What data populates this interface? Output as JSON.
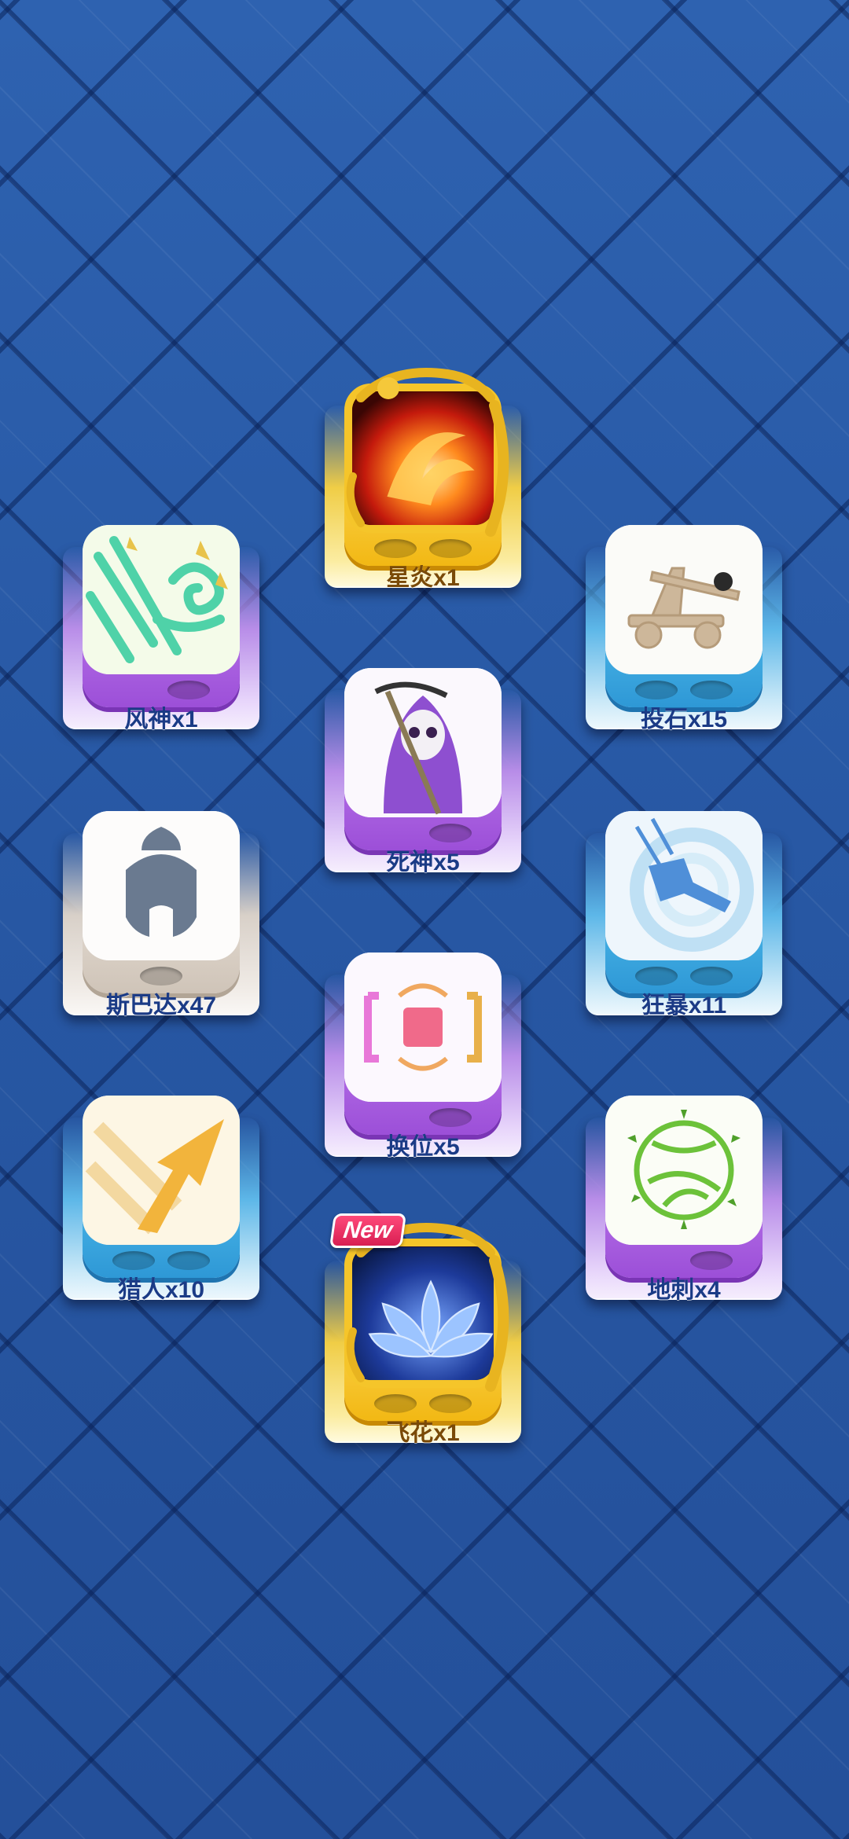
{
  "dice": [
    {
      "key": "fengshen",
      "label": "风神x1",
      "rarity": "purple"
    },
    {
      "key": "xingyan",
      "label": "星炎x1",
      "rarity": "gold"
    },
    {
      "key": "toushi",
      "label": "投石x15",
      "rarity": "blue"
    },
    {
      "key": "sishen",
      "label": "死神x5",
      "rarity": "purple"
    },
    {
      "key": "sibada",
      "label": "斯巴达x47",
      "rarity": "white"
    },
    {
      "key": "kuangbao",
      "label": "狂暴x11",
      "rarity": "blue"
    },
    {
      "key": "huanwei",
      "label": "换位x5",
      "rarity": "purple"
    },
    {
      "key": "lieren",
      "label": "猎人x10",
      "rarity": "blue"
    },
    {
      "key": "dici",
      "label": "地刺x4",
      "rarity": "purple"
    },
    {
      "key": "feihua",
      "label": "飞花x1",
      "rarity": "gold",
      "badge": "New"
    }
  ],
  "colors": {
    "background": "#2a5aa6",
    "purple": "#9c4fd8",
    "blue": "#2e98d6",
    "white": "#cfc4b8",
    "gold": "#f2b814",
    "label": "#1b3b86",
    "badge": "#d81e52"
  }
}
